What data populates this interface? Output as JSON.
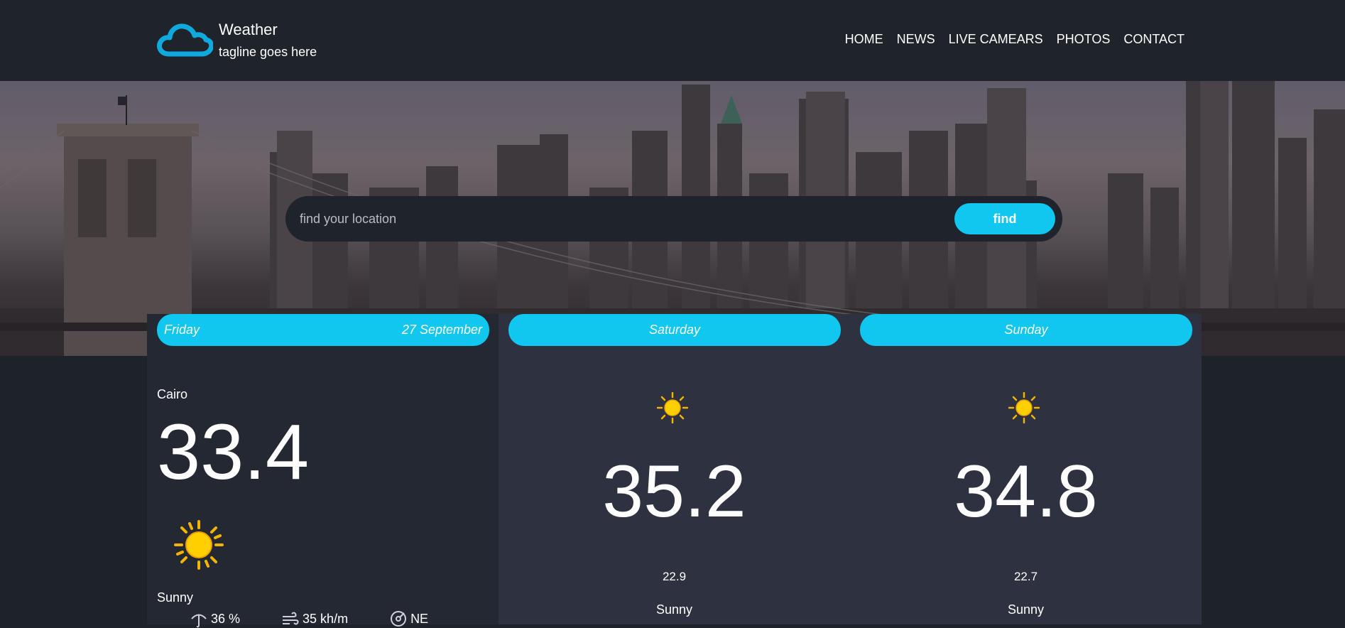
{
  "brand": {
    "title": "Weather",
    "tagline": "tagline goes here",
    "logo_icon": "cloud-icon",
    "accent_color": "#0fc7ef"
  },
  "nav": {
    "items": [
      {
        "label": "HOME"
      },
      {
        "label": "NEWS"
      },
      {
        "label": "LIVE CAMEARS"
      },
      {
        "label": "PHOTOS"
      },
      {
        "label": "CONTACT"
      }
    ]
  },
  "search": {
    "placeholder": "find your location",
    "button_label": "find"
  },
  "today": {
    "day": "Friday",
    "date": "27 September",
    "city": "Cairo",
    "temperature": "33.4",
    "icon": "sun-icon",
    "condition": "Sunny",
    "humidity": "36 %",
    "wind_speed": "35 kh/m",
    "wind_direction": "NE"
  },
  "forecast": [
    {
      "day": "Saturday",
      "icon": "sun-icon",
      "high": "35.2",
      "low": "22.9",
      "condition": "Sunny"
    },
    {
      "day": "Sunday",
      "icon": "sun-icon",
      "high": "34.8",
      "low": "22.7",
      "condition": "Sunny"
    }
  ]
}
